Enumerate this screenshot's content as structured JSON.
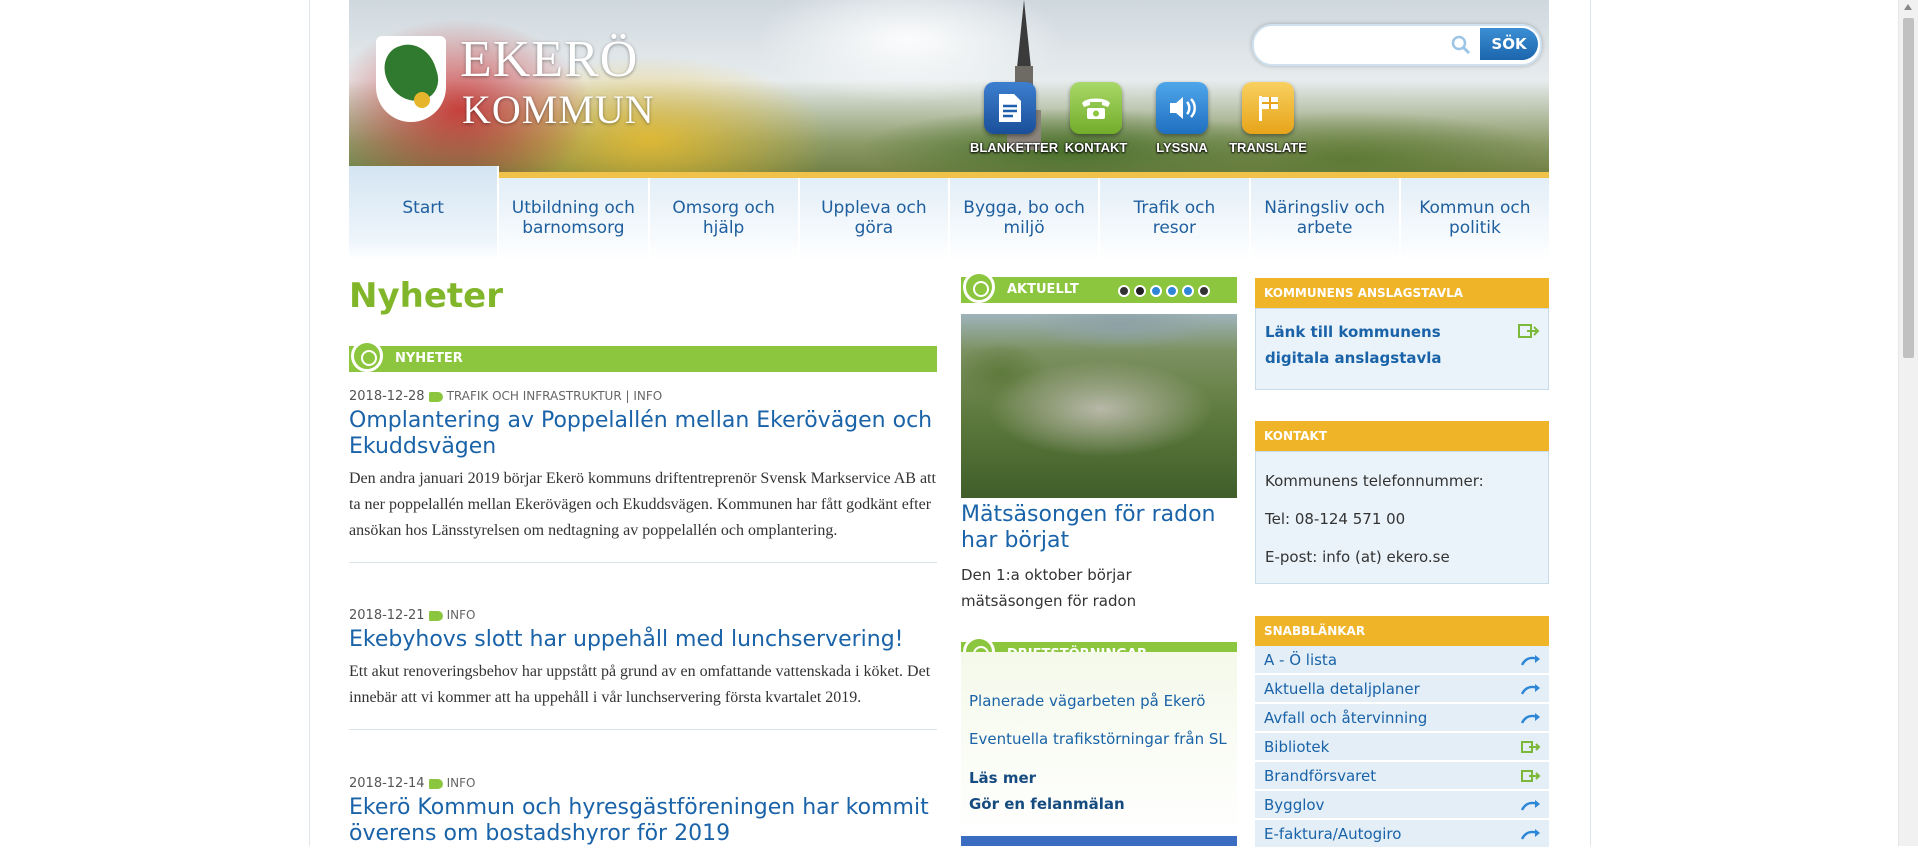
{
  "header": {
    "logo_line1": "EKERÖ",
    "logo_line2": "KOMMUN",
    "search_placeholder": "",
    "search_button": "SÖK",
    "quick_links": [
      {
        "label": "BLANKETTER",
        "icon": "document-icon",
        "color": "#1f5fae"
      },
      {
        "label": "KONTAKT",
        "icon": "phone-icon",
        "color": "#8cc63f"
      },
      {
        "label": "LYSSNA",
        "icon": "speaker-icon",
        "color": "#2d86d6"
      },
      {
        "label": "TRANSLATE",
        "icon": "flag-icon",
        "color": "#f0b428"
      }
    ]
  },
  "nav": [
    {
      "label": "Start"
    },
    {
      "label": "Utbildning och barnomsorg"
    },
    {
      "label": "Omsorg och hjälp"
    },
    {
      "label": "Uppleva och göra"
    },
    {
      "label": "Bygga, bo och miljö"
    },
    {
      "label": "Trafik och resor"
    },
    {
      "label": "Näringsliv och arbete"
    },
    {
      "label": "Kommun och politik"
    }
  ],
  "main": {
    "heading": "Nyheter",
    "section_label": "NYHETER",
    "news": [
      {
        "date": "2018-12-28",
        "categories": "TRAFIK OCH INFRASTRUKTUR | INFO",
        "title": "Omplantering av Poppelallén mellan Ekerövägen och Ekuddsvägen",
        "body": "Den andra januari 2019 börjar Ekerö kommuns driftentreprenör Svensk Markservice AB att ta ner poppelallén mellan Ekerövägen och Ekuddsvägen. Kommunen har fått godkänt efter ansökan hos Länsstyrelsen om nedtagning av poppelallén och omplantering."
      },
      {
        "date": "2018-12-21",
        "categories": "INFO",
        "title": "Ekebyhovs slott har uppehåll med lunchservering!",
        "body": "Ett akut renoveringsbehov har uppstått på grund av en omfattande vattenskada i köket. Det innebär att vi kommer att ha uppehåll i vår lunchservering första kvartalet 2019."
      },
      {
        "date": "2018-12-14",
        "categories": "INFO",
        "title": "Ekerö Kommun och hyresgästföreningen har kommit överens om bostadshyror för 2019",
        "body": ""
      }
    ]
  },
  "middle": {
    "aktuellt_label": "AKTUELLT",
    "article_title": "Mätsäsongen för radon har börjat",
    "article_text": "Den 1:a oktober börjar mätsäsongen för radon",
    "drift_label": "DRIFTSTÖRNINGAR",
    "drift_links": [
      "Planerade vägarbeten på Ekerö",
      "Eventuella trafikstörningar från SL"
    ],
    "read_more": "Läs mer",
    "report": "Gör en felanmälan"
  },
  "right": {
    "anslag_label": "KOMMUNENS ANSLAGSTAVLA",
    "anslag_link": "Länk till kommunens digitala anslagstavla",
    "kontakt_label": "KONTAKT",
    "kontakt_lines": [
      "Kommunens telefonnummer:",
      "Tel: 08-124 571 00",
      "E-post: info (at) ekero.se"
    ],
    "snabb_label": "SNABBLÄNKAR",
    "snabb_links": [
      {
        "label": "A - Ö lista",
        "icon": "arrow-icon"
      },
      {
        "label": "Aktuella detaljplaner",
        "icon": "arrow-icon"
      },
      {
        "label": "Avfall och återvinning",
        "icon": "arrow-icon"
      },
      {
        "label": "Bibliotek",
        "icon": "external-link-icon"
      },
      {
        "label": "Brandförsvaret",
        "icon": "external-link-icon"
      },
      {
        "label": "Bygglov",
        "icon": "arrow-icon"
      },
      {
        "label": "E-faktura/Autogiro",
        "icon": "arrow-icon"
      }
    ]
  },
  "colors": {
    "green": "#8cc63f",
    "orange": "#f0b428",
    "link": "#1a63a8"
  }
}
